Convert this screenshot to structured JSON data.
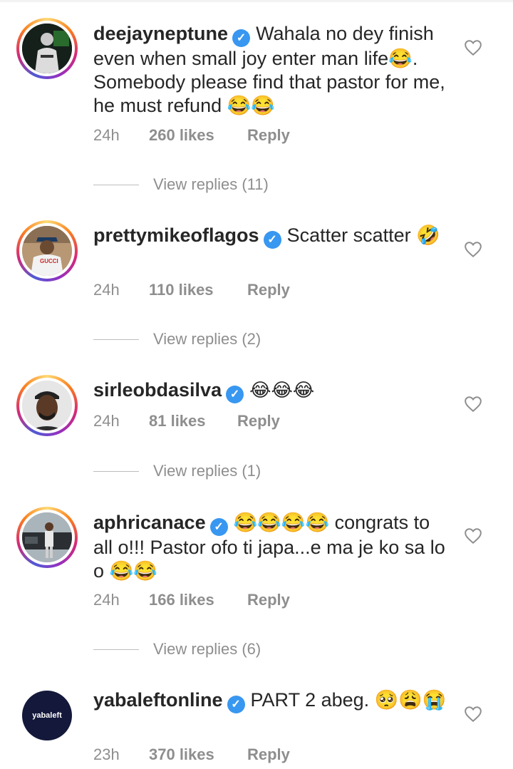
{
  "comments": [
    {
      "username": "deejayneptune",
      "text": "Wahala no dey finish even when small joy enter man life😂. Somebody please find that pastor for me, he must refund 😂😂",
      "time": "24h",
      "likes": "260 likes",
      "reply": "Reply",
      "view_replies": "View replies (11)"
    },
    {
      "username": "prettymikeoflagos",
      "text": "Scatter scatter 🤣",
      "time": "24h",
      "likes": "110 likes",
      "reply": "Reply",
      "view_replies": "View replies (2)"
    },
    {
      "username": "sirleobdasilva",
      "text": "😂😂😂",
      "time": "24h",
      "likes": "81 likes",
      "reply": "Reply",
      "view_replies": "View replies (1)"
    },
    {
      "username": "aphricanace",
      "text": "😂😂😂😂 congrats to all o!!! Pastor ofo ti japa...e ma je ko sa lo o 😂😂",
      "time": "24h",
      "likes": "166 likes",
      "reply": "Reply",
      "view_replies": "View replies (6)"
    },
    {
      "username": "yabaleftonline",
      "text": "PART 2 abeg. 🥺😩😭",
      "time": "23h",
      "likes": "370 likes",
      "reply": "Reply",
      "avatar_logo_text": "yabaleft"
    }
  ],
  "colors": {
    "verified": "#3897f0",
    "meta": "#8e8e8e",
    "text": "#262626"
  },
  "icons": {
    "verified": "verified-badge-icon",
    "like": "heart-outline-icon"
  }
}
